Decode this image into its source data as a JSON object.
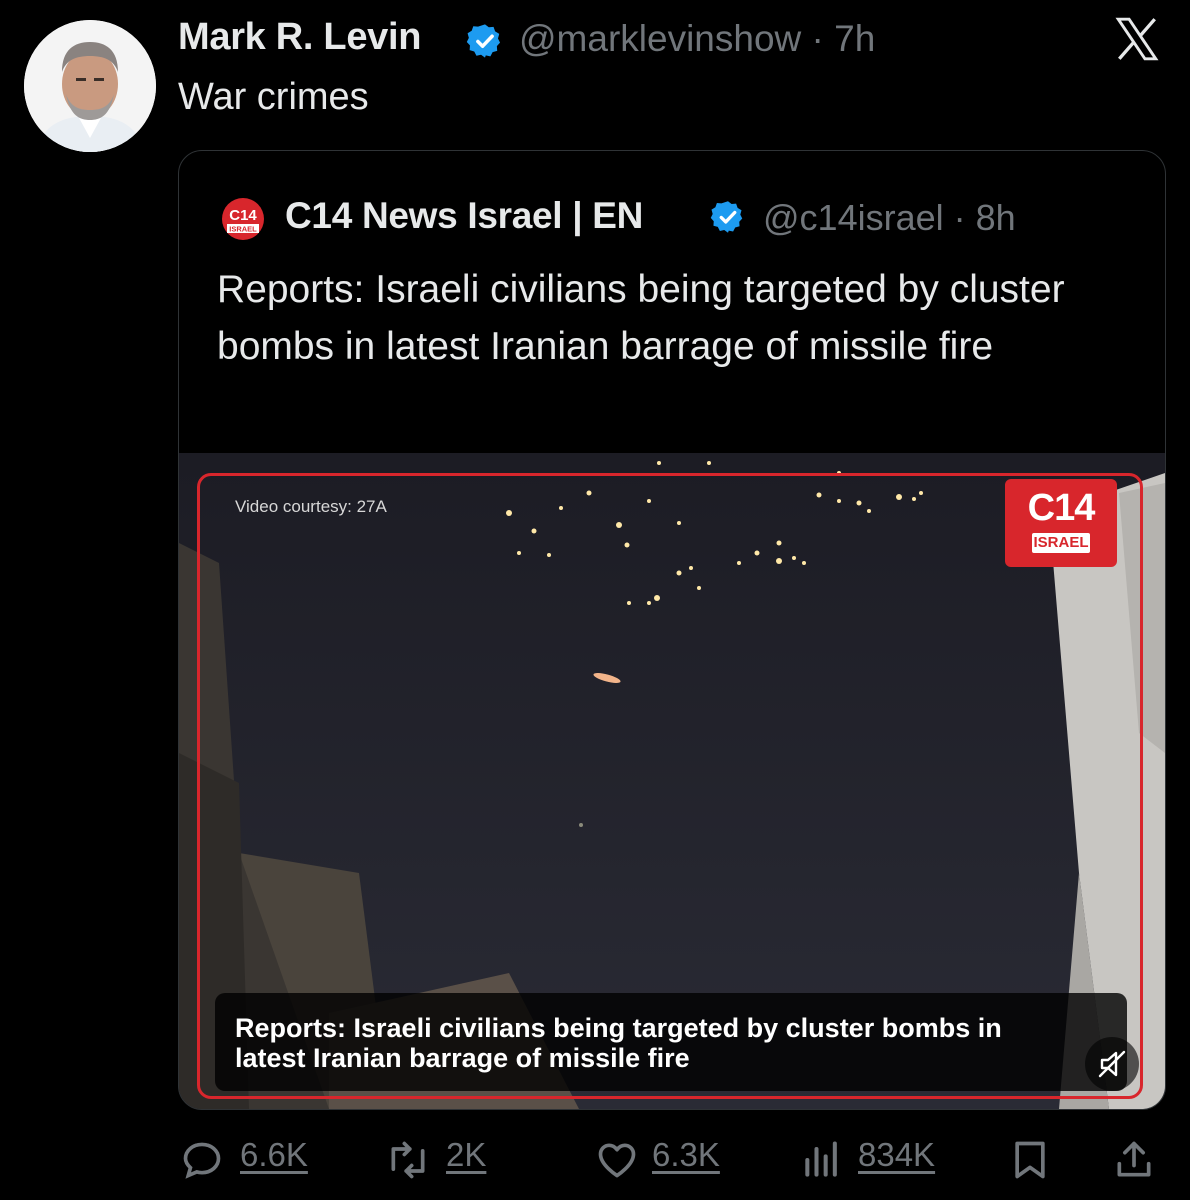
{
  "tweet": {
    "author_name": "Mark R. Levin",
    "handle_time": "@marklevinshow · 7h",
    "text": "War crimes",
    "avatar_icon": "portrait-photo"
  },
  "quoted": {
    "author_name": "C14 News Israel | EN",
    "handle_time": "@c14israel · 8h",
    "text": "Reports: Israeli civilians being targeted by cluster bombs in latest Iranian barrage of missile fire",
    "video": {
      "courtesy": "Video courtesy: 27A",
      "badge_main": "C14",
      "badge_sub": "ISRAEL",
      "caption": "Reports: Israeli civilians being targeted by cluster bombs in latest Iranian barrage of missile fire"
    }
  },
  "actions": {
    "replies": "6.6K",
    "reposts": "2K",
    "likes": "6.3K",
    "views": "834K"
  },
  "colors": {
    "background": "#000000",
    "text": "#e7e9ea",
    "muted": "#71767b",
    "verified": "#1d9bf0",
    "brand_red": "#d8262c"
  }
}
